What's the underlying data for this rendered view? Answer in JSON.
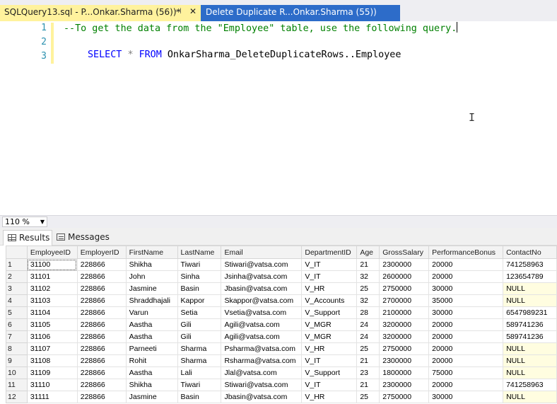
{
  "tabs": {
    "active_label": "SQLQuery13.sql - P...Onkar.Sharma (56))*",
    "pin_glyph": "⊣",
    "close_glyph": "✕",
    "inactive_label": "Delete Duplicate R...Onkar.Sharma (55))"
  },
  "editor": {
    "line_numbers": [
      "1",
      "2",
      "3"
    ],
    "comment_line": "--To get the data from the \"Employee\" table, use the following query.",
    "select_kw": "SELECT",
    "star": "*",
    "from_kw": "FROM",
    "table_ref": "OnkarSharma_DeleteDuplicateRows..Employee"
  },
  "zoom": {
    "value": "110 %"
  },
  "results": {
    "tab_results": "Results",
    "tab_messages": "Messages",
    "columns": [
      "EmployeeID",
      "EmployerID",
      "FirstName",
      "LastName",
      "Email",
      "DepartmentID",
      "Age",
      "GrossSalary",
      "PerformanceBonus",
      "ContactNo"
    ],
    "rows": [
      [
        "1",
        "31100",
        "228866",
        "Shikha",
        "Tiwari",
        "Stiwari@vatsa.com",
        "V_IT",
        "21",
        "2300000",
        "20000",
        "741258963"
      ],
      [
        "2",
        "31101",
        "228866",
        "John",
        "Sinha",
        "Jsinha@vatsa.com",
        "V_IT",
        "32",
        "2600000",
        "20000",
        "123654789"
      ],
      [
        "3",
        "31102",
        "228866",
        "Jasmine",
        "Basin",
        "Jbasin@vatsa.com",
        "V_HR",
        "25",
        "2750000",
        "30000",
        "NULL"
      ],
      [
        "4",
        "31103",
        "228866",
        "Shraddhajali",
        "Kappor",
        "Skappor@vatsa.com",
        "V_Accounts",
        "32",
        "2700000",
        "35000",
        "NULL"
      ],
      [
        "5",
        "31104",
        "228866",
        "Varun",
        "Setia",
        "Vsetia@vatsa.com",
        "V_Support",
        "28",
        "2100000",
        "30000",
        "6547989231"
      ],
      [
        "6",
        "31105",
        "228866",
        "Aastha",
        "Gili",
        "Agili@vatsa.com",
        "V_MGR",
        "24",
        "3200000",
        "20000",
        "589741236"
      ],
      [
        "7",
        "31106",
        "228866",
        "Aastha",
        "Gili",
        "Agili@vatsa.com",
        "V_MGR",
        "24",
        "3200000",
        "20000",
        "589741236"
      ],
      [
        "8",
        "31107",
        "228866",
        "Parneeti",
        "Sharma",
        "Psharma@vatsa.com",
        "V_HR",
        "25",
        "2750000",
        "20000",
        "NULL"
      ],
      [
        "9",
        "31108",
        "228866",
        "Rohit",
        "Sharma",
        "Rsharma@vatsa.com",
        "V_IT",
        "21",
        "2300000",
        "20000",
        "NULL"
      ],
      [
        "10",
        "31109",
        "228866",
        "Aastha",
        "Lali",
        "Jlal@vatsa.com",
        "V_Support",
        "23",
        "1800000",
        "75000",
        "NULL"
      ],
      [
        "11",
        "31110",
        "228866",
        "Shikha",
        "Tiwari",
        "Stiwari@vatsa.com",
        "V_IT",
        "21",
        "2300000",
        "20000",
        "741258963"
      ],
      [
        "12",
        "31111",
        "228866",
        "Jasmine",
        "Basin",
        "Jbasin@vatsa.com",
        "V_HR",
        "25",
        "2750000",
        "30000",
        "NULL"
      ]
    ]
  },
  "colors": {
    "active_tab": "#fff29d",
    "inactive_tab": "#2d6cc9",
    "comment": "#008000",
    "keyword": "#0000ff",
    "null_cell": "#fffde0"
  }
}
